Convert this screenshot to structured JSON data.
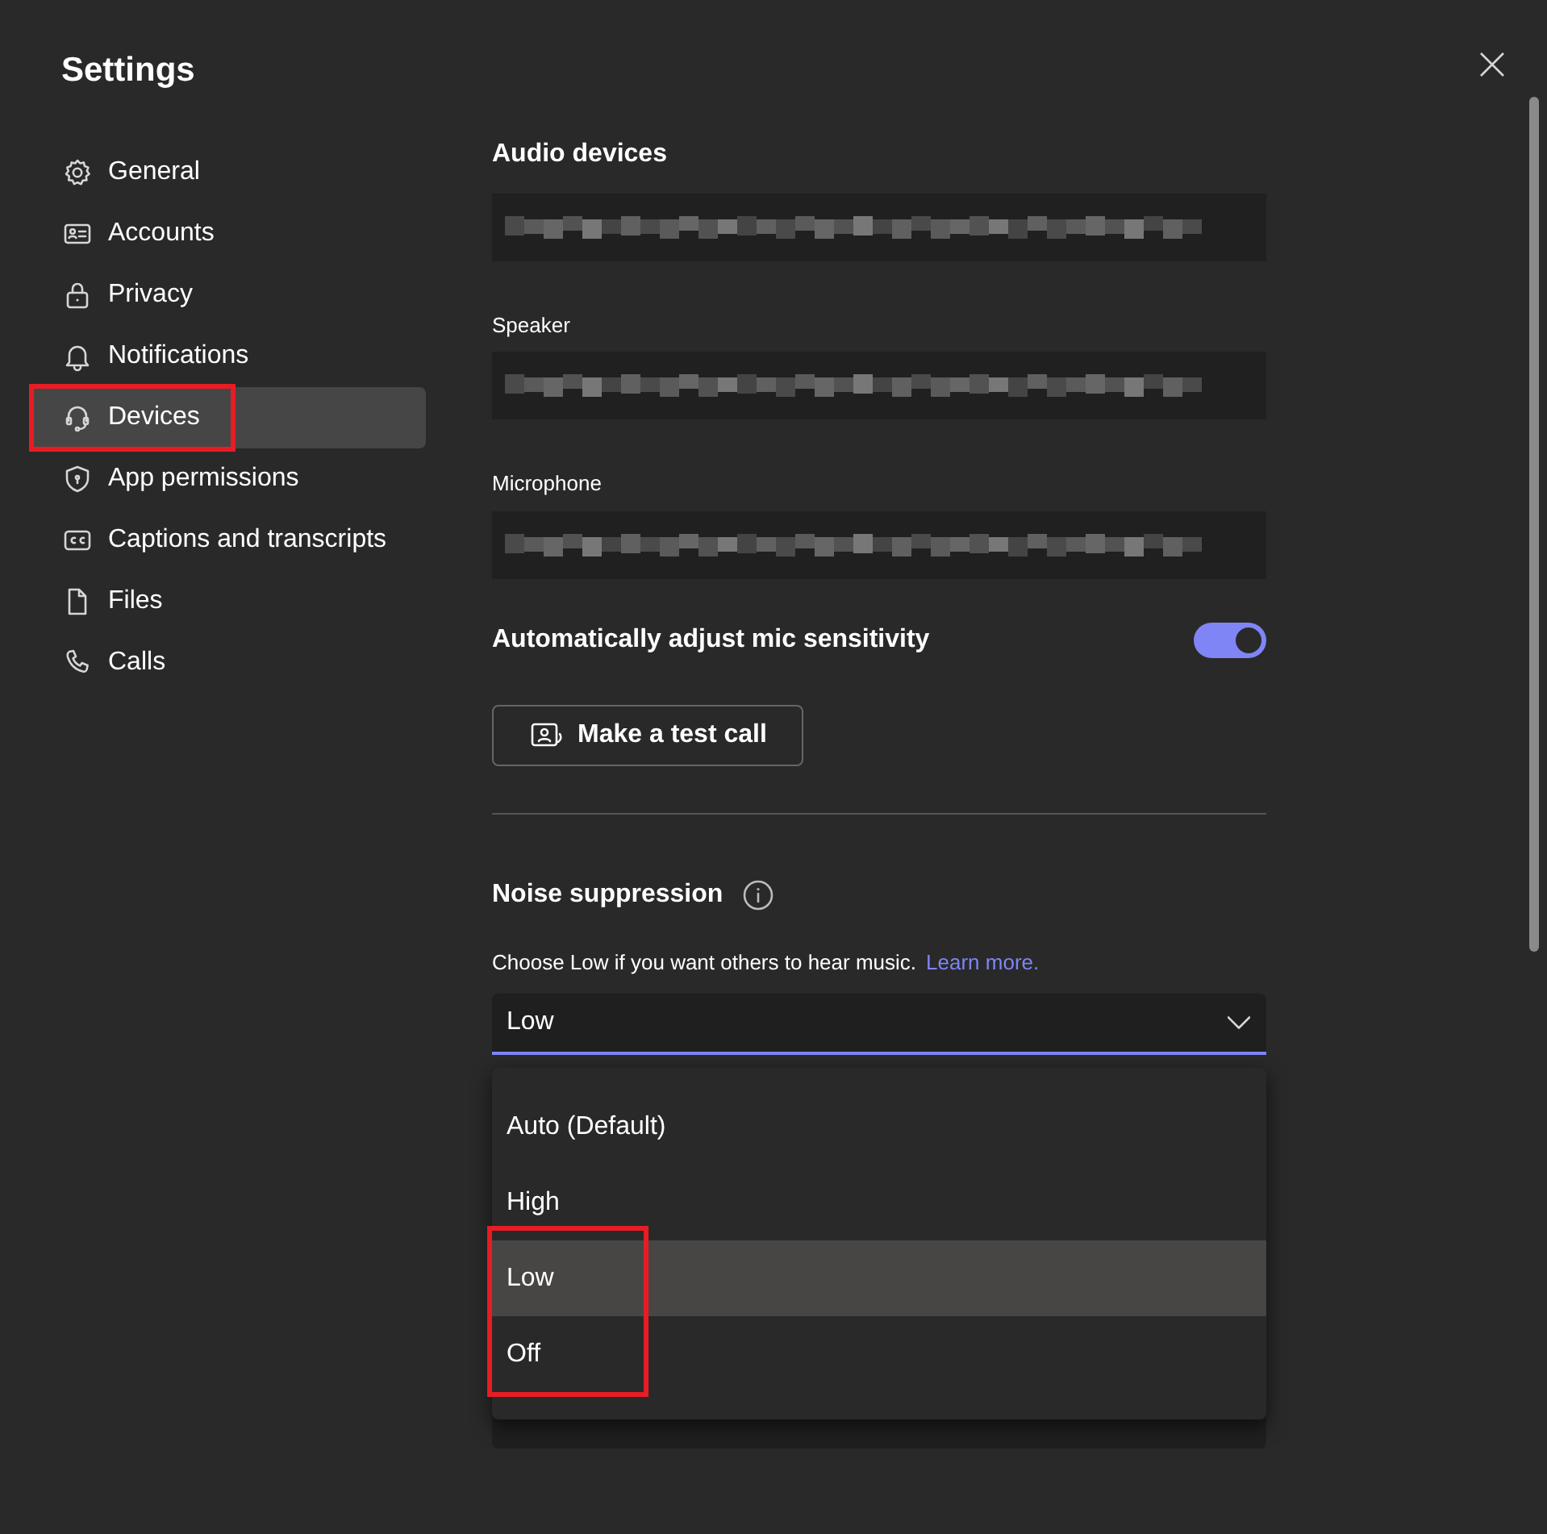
{
  "window": {
    "title": "Settings"
  },
  "sidebar": {
    "items": [
      {
        "label": "General",
        "kind": "gear",
        "selected": false,
        "marked": false
      },
      {
        "label": "Accounts",
        "kind": "card",
        "selected": false,
        "marked": false
      },
      {
        "label": "Privacy",
        "kind": "lock",
        "selected": false,
        "marked": false
      },
      {
        "label": "Notifications",
        "kind": "bell",
        "selected": false,
        "marked": false
      },
      {
        "label": "Devices",
        "kind": "headset",
        "selected": true,
        "marked": true
      },
      {
        "label": "App permissions",
        "kind": "shield",
        "selected": false,
        "marked": false
      },
      {
        "label": "Captions and transcripts",
        "kind": "cc",
        "selected": false,
        "marked": false
      },
      {
        "label": "Files",
        "kind": "file",
        "selected": false,
        "marked": false
      },
      {
        "label": "Calls",
        "kind": "phone",
        "selected": false,
        "marked": false
      }
    ]
  },
  "content": {
    "heading": "Audio devices",
    "device_fields": [
      {
        "kind": "plain"
      },
      {
        "kind": "labeled",
        "label": "Speaker"
      },
      {
        "kind": "labeled",
        "label": "Microphone"
      }
    ],
    "mic_toggle": {
      "label": "Automatically adjust mic sensitivity",
      "on": true
    },
    "test_call_button": "Make a test call",
    "noise": {
      "title": "Noise suppression",
      "description": "Choose Low if you want others to hear music.",
      "link": "Learn more.",
      "value": "Low",
      "options": [
        {
          "label": "Auto (Default)",
          "selected": false,
          "marked": false
        },
        {
          "label": "High",
          "selected": false,
          "marked": false
        },
        {
          "label": "Low",
          "selected": true,
          "marked": true
        },
        {
          "label": "Off",
          "selected": false,
          "marked": true
        }
      ]
    }
  }
}
